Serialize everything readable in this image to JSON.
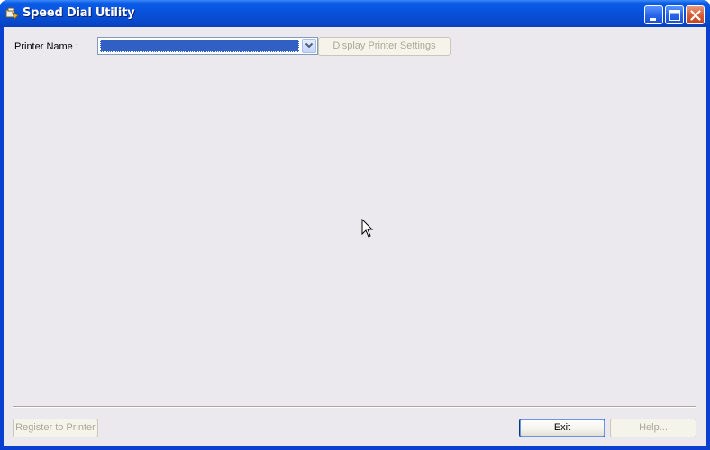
{
  "window": {
    "title": "Speed Dial Utility",
    "title_bar_color": "#0851d9"
  },
  "title_buttons": {
    "minimize_icon": "minimize-icon",
    "maximize_icon": "maximize-icon",
    "close_icon": "close-icon"
  },
  "form": {
    "printer_name_label": "Printer Name :",
    "printer_select": {
      "value": "",
      "selection_color": "#3160c4"
    },
    "display_settings_label": "Display Printer Settings"
  },
  "footer": {
    "register_label": "Register to Printer",
    "exit_label": "Exit",
    "help_label": "Help..."
  }
}
